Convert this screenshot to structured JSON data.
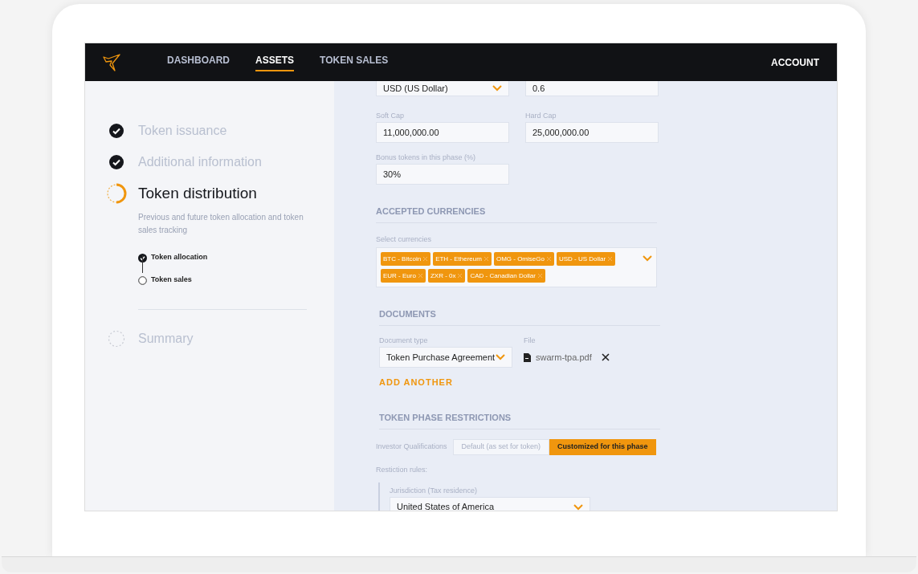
{
  "nav": {
    "items": [
      {
        "label": "DASHBOARD",
        "selected": false
      },
      {
        "label": "ASSETS",
        "selected": true
      },
      {
        "label": "TOKEN SALES",
        "selected": false
      }
    ],
    "account": "ACCOUNT"
  },
  "steps": [
    {
      "label": "Token issuance",
      "kind": "done"
    },
    {
      "label": "Additional information",
      "kind": "done"
    },
    {
      "label": "Token distribution",
      "kind": "current",
      "description": "Previous and future token allocation and token sales tracking",
      "substeps": [
        {
          "label": "Token allocation",
          "checked": true
        },
        {
          "label": "Token sales",
          "checked": false
        }
      ]
    },
    {
      "label": "Summary",
      "kind": "pending"
    }
  ],
  "form": {
    "top_row": [
      {
        "kind": "select",
        "value": "USD (US Dollar)"
      },
      {
        "kind": "text",
        "value": "0.6"
      }
    ],
    "caps": [
      {
        "label": "Soft Cap",
        "value": "11,000,000.00"
      },
      {
        "label": "Hard Cap",
        "value": "25,000,000.00"
      }
    ],
    "bonus": {
      "label": "Bonus tokens in this phase (%)",
      "value": "30%"
    },
    "accepted_currencies": {
      "heading": "ACCEPTED CURRENCIES",
      "label": "Select currencies",
      "tags": [
        "BTC - Bitcoin",
        "ETH - Ethereum",
        "OMG - OmiseGo",
        "USD - US Dollar",
        "EUR - Euro",
        "ZXR - 0x",
        "CAD - Canadian Dollar"
      ]
    },
    "documents": {
      "heading": "DOCUMENTS",
      "type_label": "Document type",
      "type_value": "Token Purchase Agreement",
      "file_label": "File",
      "file_name": "swarm-tpa.pdf",
      "add_button": "ADD ANOTHER"
    },
    "restrictions": {
      "heading": "TOKEN PHASE RESTRICTIONS",
      "qualifications_label": "Investor Qualifications",
      "options": [
        {
          "label": "Default (as set for token)",
          "selected": false
        },
        {
          "label": "Customized for this phase",
          "selected": true
        }
      ],
      "rules_label": "Restiction rules:",
      "jurisdiction": {
        "label": "Jurisdiction (Tax residence)",
        "value": "United States of America"
      }
    }
  }
}
